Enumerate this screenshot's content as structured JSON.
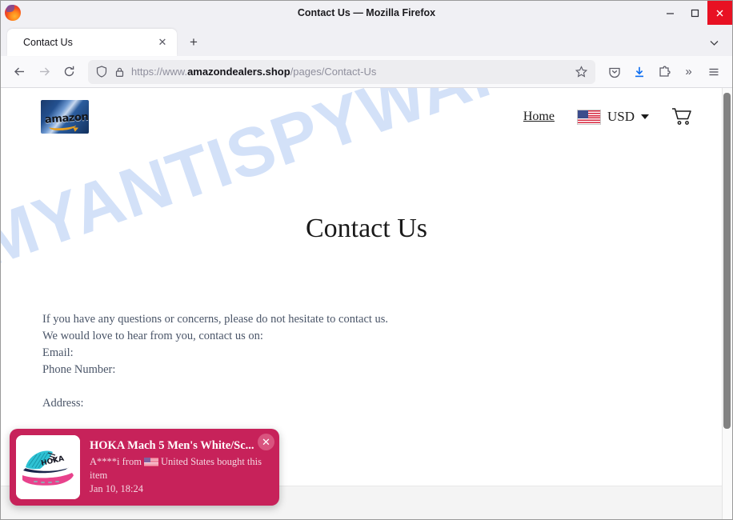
{
  "window": {
    "title": "Contact Us — Mozilla Firefox",
    "minimize_label": "minimize",
    "maximize_label": "maximize",
    "close_label": "close"
  },
  "tabs": {
    "items": [
      {
        "label": "Contact Us",
        "close_glyph": "✕"
      }
    ],
    "new_tab_glyph": "+",
    "list_all_glyph": "⌄"
  },
  "toolbar": {
    "back_glyph": "←",
    "forward_glyph": "→",
    "reload_glyph": "⟳",
    "url_prefix": "https://www.",
    "url_host": "amazondealers.shop",
    "url_path": "/pages/Contact-Us",
    "bookmark_glyph": "☆",
    "overflow_glyph": "»",
    "menu_glyph": "☰"
  },
  "site": {
    "logo_wordmark": "amazon",
    "nav": {
      "home": "Home",
      "currency": "USD",
      "flag_alt": "United States flag",
      "cart_alt": "shopping cart"
    }
  },
  "page": {
    "watermark": "MYANTISPYWARE.COM",
    "title": "Contact Us",
    "lines": [
      "If you have any questions or concerns, please do not hesitate to contact us.",
      "We would love to hear from you, contact us on:",
      "Email:",
      "Phone Number:"
    ],
    "address_label": "Address:"
  },
  "toast": {
    "product_title": "HOKA Mach 5 Men's White/Sc...",
    "buyer_prefix": "A****i from",
    "buyer_country": "United States bought this item",
    "timestamp": "Jan 10, 18:24",
    "close_glyph": "✕",
    "accent_color": "#c7225a",
    "product_alt": "HOKA Mach 5 running shoe"
  }
}
